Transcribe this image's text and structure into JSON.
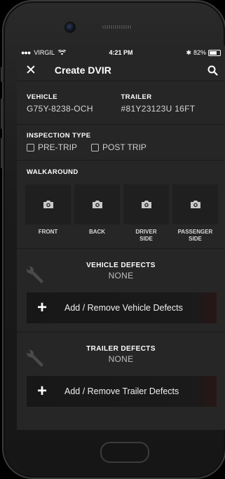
{
  "status": {
    "carrier": "VIRGIL",
    "time": "4:21 PM",
    "battery": "82%",
    "battery_level": 0.82
  },
  "nav": {
    "title": "Create DVIR"
  },
  "vehicle": {
    "label": "VEHICLE",
    "value": "G75Y-8238-OCH"
  },
  "trailer": {
    "label": "TRAILER",
    "value": "#81Y23123U 16FT"
  },
  "inspection": {
    "label": "INSPECTION TYPE",
    "options": [
      "PRE-TRIP",
      "POST TRIP"
    ]
  },
  "walkaround": {
    "label": "WALKAROUND",
    "items": [
      {
        "label": "FRONT"
      },
      {
        "label": "BACK"
      },
      {
        "label": "DRIVER\nSIDE"
      },
      {
        "label": "PASSENGER\nSIDE"
      }
    ]
  },
  "vehicle_defects": {
    "title": "VEHICLE DEFECTS",
    "value": "NONE",
    "action": "Add / Remove Vehicle Defects"
  },
  "trailer_defects": {
    "title": "TRAILER DEFECTS",
    "value": "NONE",
    "action": "Add / Remove Trailer Defects"
  }
}
